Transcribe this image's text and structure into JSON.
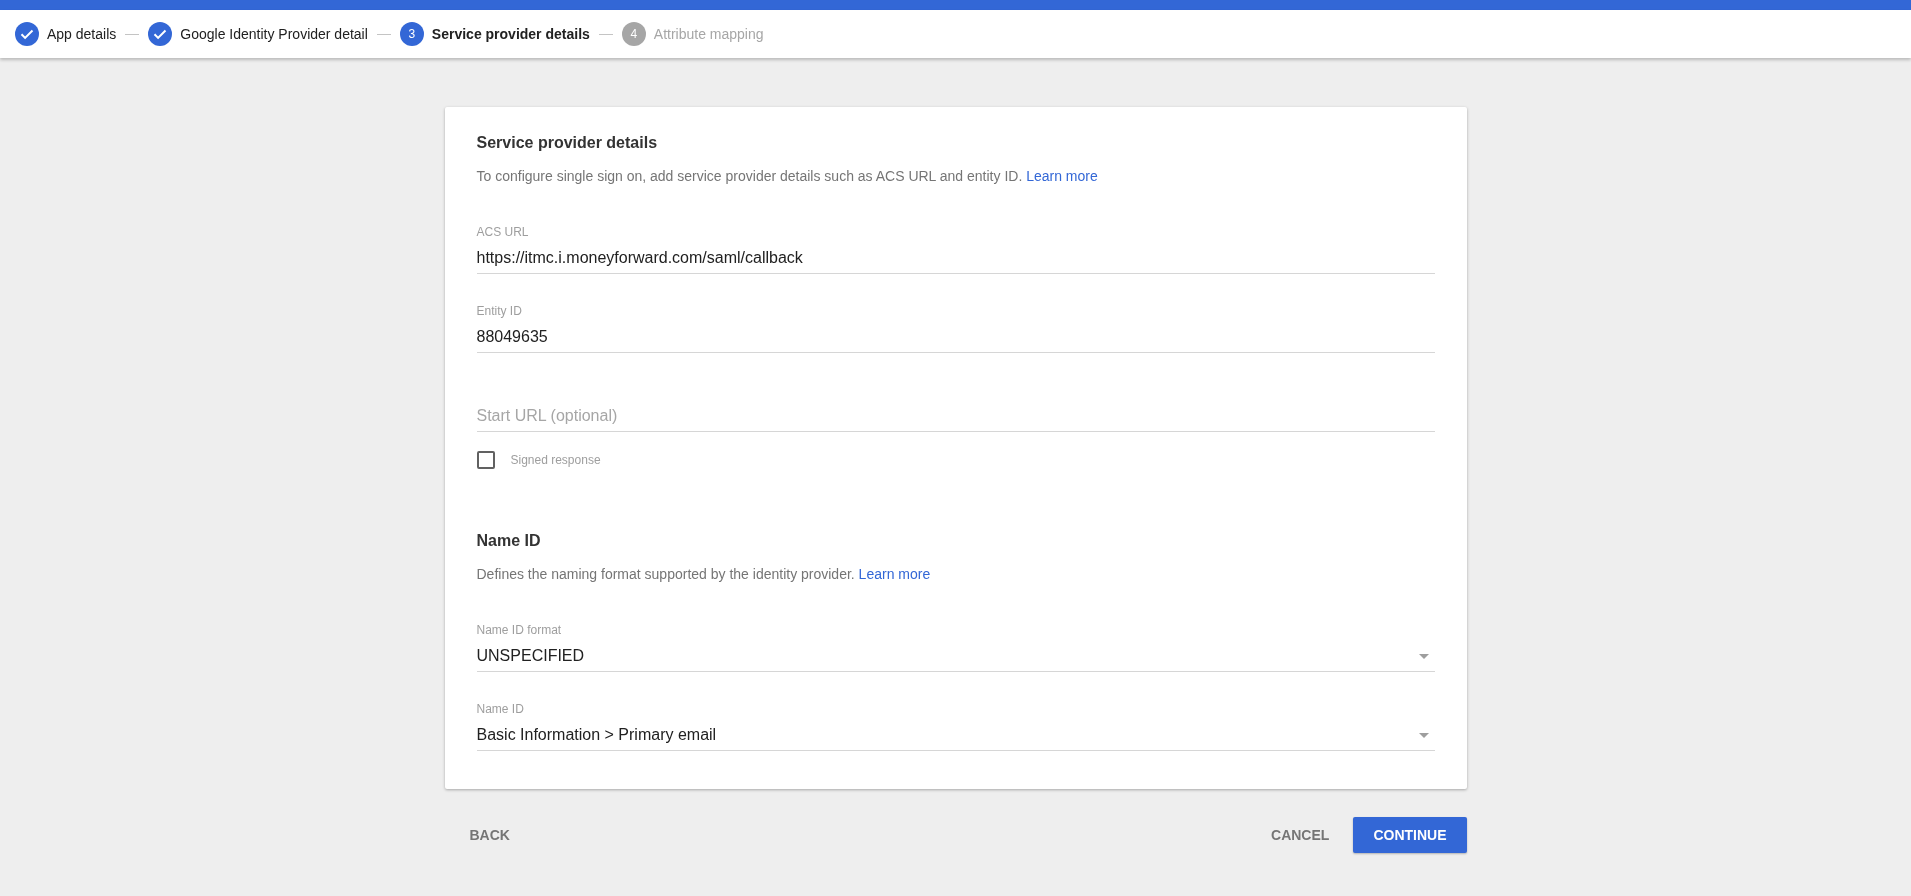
{
  "stepper": [
    {
      "label": "App details",
      "completed": true,
      "selected": false
    },
    {
      "label": "Google Identity Provider detail",
      "completed": true,
      "selected": false
    },
    {
      "label": "Service provider details",
      "number": "3",
      "completed": false,
      "selected": true
    },
    {
      "label": "Attribute mapping",
      "number": "4",
      "completed": false,
      "selected": false
    }
  ],
  "sections": [
    {
      "title": "Service provider details",
      "description": "To configure single sign on, add service provider details such as ACS URL and entity ID.",
      "link": "Learn more",
      "fields": [
        {
          "kind": "text",
          "label": "ACS URL",
          "value": "https://itmc.i.moneyforward.com/saml/callback"
        },
        {
          "kind": "text",
          "label": "Entity ID",
          "value": "88049635"
        },
        {
          "kind": "text",
          "placeholder": "Start URL (optional)"
        },
        {
          "kind": "checkbox",
          "label": "Signed response",
          "checked": false
        }
      ]
    },
    {
      "title": "Name ID",
      "description": "Defines the naming format supported by the identity provider.",
      "link": "Learn more",
      "fields": [
        {
          "kind": "select",
          "label": "Name ID format",
          "value": "UNSPECIFIED"
        },
        {
          "kind": "select",
          "label": "Name ID",
          "value": "Basic Information > Primary email"
        }
      ]
    }
  ],
  "actions": {
    "back": "BACK",
    "cancel": "CANCEL",
    "continue": "CONTINUE"
  }
}
